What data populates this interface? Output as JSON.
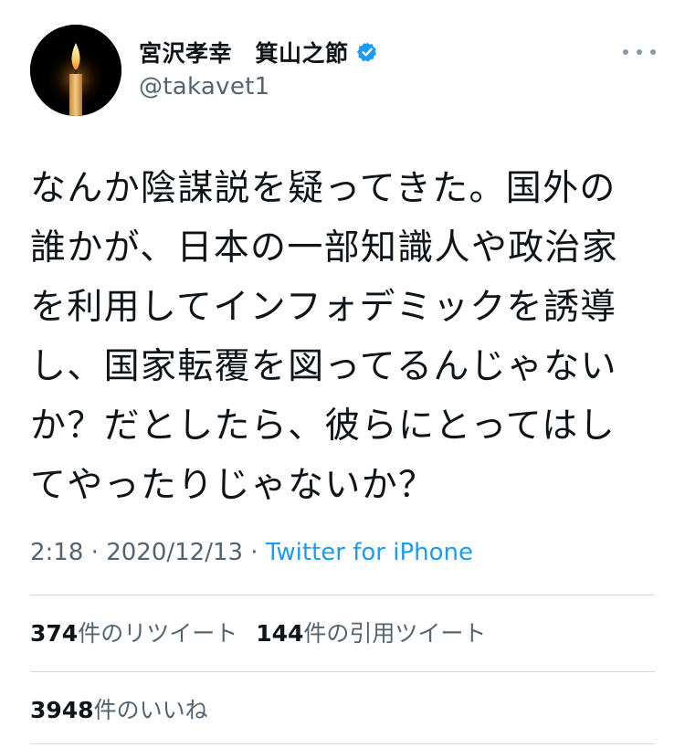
{
  "user": {
    "display_name": "宮沢孝幸　箕山之節",
    "handle": "@takavet1",
    "verified": true
  },
  "icons": {
    "avatar": "candle-image",
    "verified": "verified-badge-icon",
    "more": "more-options-icon"
  },
  "colors": {
    "accent": "#1d9bf0",
    "secondary_text": "#536471",
    "divider": "#cfd9de"
  },
  "tweet": {
    "lines": [
      "なんか陰謀説を疑ってきた。国外の",
      "誰かが、日本の一部知識人や政治家",
      "を利用してインフォデミックを誘導",
      "し、国家転覆を図ってるんじゃない",
      "か？だとしたら、彼らにとってはし",
      "てやったりじゃないか？"
    ]
  },
  "meta": {
    "time": "2:18",
    "separator": " · ",
    "date": "2020/12/13",
    "source": "Twitter for iPhone"
  },
  "stats": {
    "retweets_count": "374",
    "retweets_label": "件のリツイート",
    "quotes_count": "144",
    "quotes_label": "件の引用ツイート",
    "likes_count": "3948",
    "likes_label": "件のいいね"
  }
}
